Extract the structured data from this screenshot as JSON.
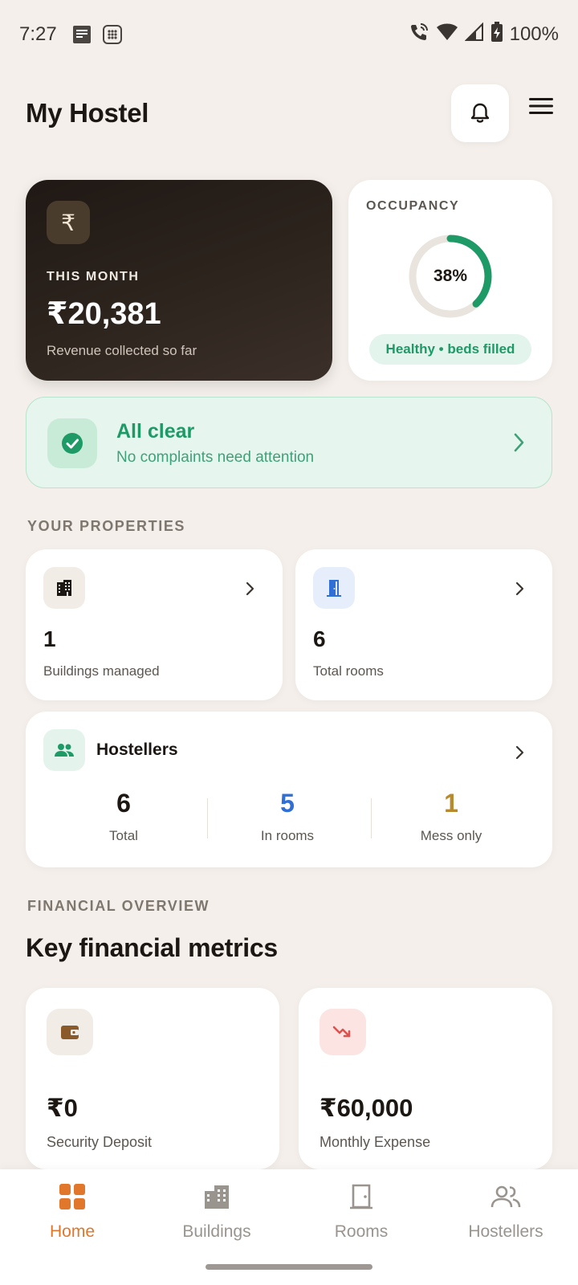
{
  "status_bar": {
    "time": "7:27",
    "battery": "100%"
  },
  "header": {
    "title": "My Hostel"
  },
  "revenue": {
    "currency_symbol": "₹",
    "label": "THIS MONTH",
    "value": "₹20,381",
    "subtitle": "Revenue collected so far"
  },
  "occupancy": {
    "label": "OCCUPANCY",
    "percent_text": "38%",
    "percent": 0.38,
    "badge": "Healthy • beds filled",
    "accent": "#1e9a67"
  },
  "alert": {
    "title": "All clear",
    "subtitle": "No complaints need attention"
  },
  "properties": {
    "section_label": "YOUR PROPERTIES",
    "buildings": {
      "value": "1",
      "label": "Buildings managed"
    },
    "rooms": {
      "value": "6",
      "label": "Total rooms"
    }
  },
  "hostellers": {
    "title": "Hostellers",
    "stats": [
      {
        "value": "6",
        "label": "Total",
        "color": "#1c1712"
      },
      {
        "value": "5",
        "label": "In rooms",
        "color": "#2f6fd6"
      },
      {
        "value": "1",
        "label": "Mess only",
        "color": "#b88a2e"
      }
    ]
  },
  "financial": {
    "section_label": "FINANCIAL OVERVIEW",
    "heading": "Key financial metrics",
    "cards": [
      {
        "value": "₹0",
        "label": "Security Deposit",
        "icon": "wallet-icon"
      },
      {
        "value": "₹60,000",
        "label": "Monthly Expense",
        "icon": "trending-down-icon"
      }
    ]
  },
  "nav": {
    "accent": "#e0772b",
    "items": [
      {
        "label": "Home",
        "icon": "home-grid-icon",
        "active": true
      },
      {
        "label": "Buildings",
        "icon": "buildings-icon",
        "active": false
      },
      {
        "label": "Rooms",
        "icon": "door-icon",
        "active": false
      },
      {
        "label": "Hostellers",
        "icon": "people-icon",
        "active": false
      }
    ]
  }
}
